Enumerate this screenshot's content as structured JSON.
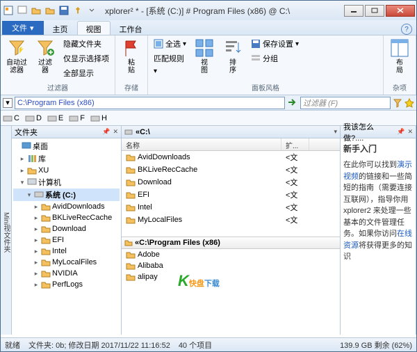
{
  "title": "xplorer² * - [系统 (C:)] # Program Files (x86) @ C:\\",
  "tabs": {
    "file": "文件",
    "home": "主页",
    "view": "视图",
    "work": "工作台"
  },
  "ribbon": {
    "filters": {
      "auto": "自动过\n滤器",
      "filter": "过滤\n器",
      "hide": "隐藏文件夹",
      "showsel": "仅显示选择项",
      "showall": "全部显示",
      "group": "过滤器"
    },
    "clip": {
      "paste": "粘\n贴",
      "group": "存储"
    },
    "panel": {
      "selall": "全选",
      "match": "匹配规则",
      "view": "视\n图",
      "sort": "排\n序",
      "save": "保存设置",
      "group": "面板风格"
    },
    "sub": "分组",
    "misc": {
      "layout": "布\n局",
      "group": "杂项"
    }
  },
  "address": {
    "path": "C:\\Program Files (x86)",
    "filter_ph": "过滤器 (F)"
  },
  "drives": [
    "C",
    "D",
    "E",
    "F",
    "H"
  ],
  "sidetab": "Mini视文件夹",
  "treepane": {
    "title": "文件夹",
    "desktop": "桌面",
    "lib": "库",
    "user": "XU",
    "computer": "计算机",
    "sysc": "系统 (C:)",
    "folders": [
      "AvidDownloads",
      "BKLiveRecCache",
      "Download",
      "EFI",
      "Intel",
      "MyLocalFiles",
      "NVIDIA",
      "PerfLogs"
    ]
  },
  "toppane": {
    "title": "«C:\\",
    "col_name": "名称",
    "col_ext": "扩...",
    "rows": [
      {
        "n": "AvidDownloads",
        "e": "<文"
      },
      {
        "n": "BKLiveRecCache",
        "e": "<文"
      },
      {
        "n": "Download",
        "e": "<文"
      },
      {
        "n": "EFI",
        "e": "<文"
      },
      {
        "n": "Intel",
        "e": "<文"
      },
      {
        "n": "MyLocalFiles",
        "e": "<文"
      }
    ]
  },
  "bottompane": {
    "title": "«C:\\Program Files (x86)",
    "rows": [
      "Adobe",
      "Alibaba",
      "alipay"
    ]
  },
  "helppane": {
    "title": "我该怎么做?....",
    "heading": "新手入门",
    "body1": "在此你可以找到",
    "link1": "演示视频",
    "body2": "的链接和一些简短的指南（需要连接互联网），指导你用 xplorer2 来处理一些基本的文件管理任务。如果你访问",
    "link2": "在线资源",
    "body3": "将获得更多的知识"
  },
  "status": {
    "ready": "就绪",
    "info": "文件夹: 0b; 修改日期 2017/11/22 11:16:52",
    "count": "40 个项目",
    "disk": "139.9 GB 剩余 (62%)"
  },
  "watermark": {
    "t1": "快盘",
    "t2": "下载"
  }
}
